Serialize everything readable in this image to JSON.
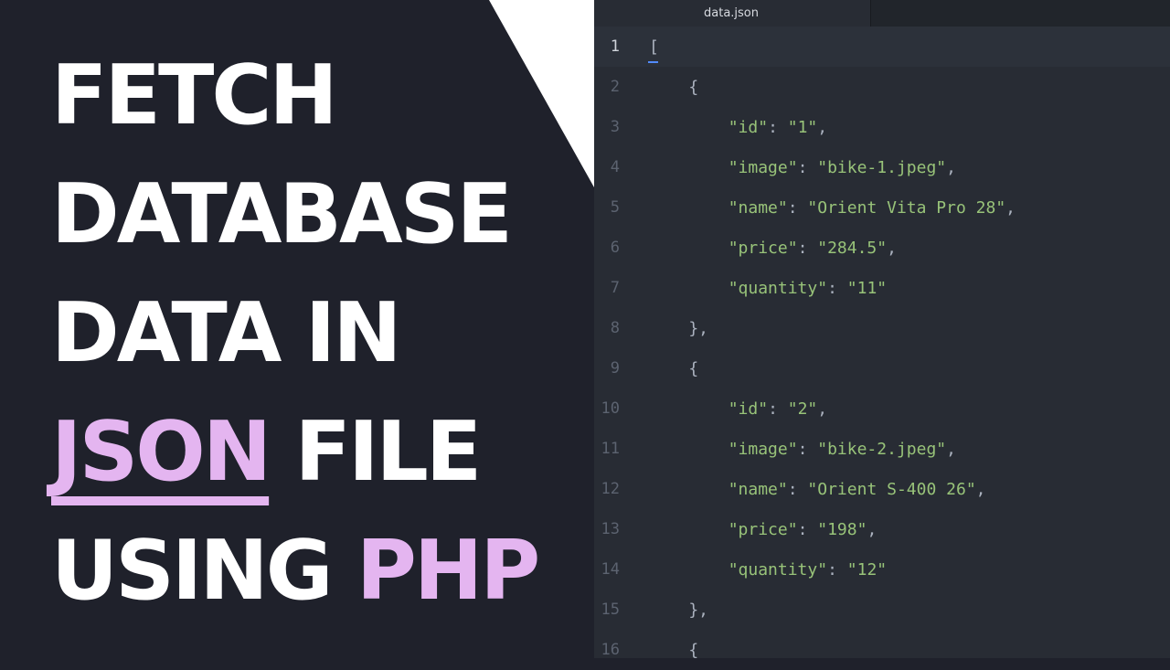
{
  "title": {
    "line1": "FETCH",
    "line2": "DATABASE",
    "line3": "DATA IN",
    "line4_highlight": "JSON",
    "line4_rest": " FILE",
    "line5_text": "USING ",
    "line5_highlight": "PHP"
  },
  "colors": {
    "accent": "#e4b5f0",
    "background": "#1f212b",
    "editor_bg": "#282c34",
    "string": "#98c379"
  },
  "editor": {
    "tab_label": "data.json",
    "lines": [
      {
        "n": "1",
        "indent": "",
        "text": "["
      },
      {
        "n": "2",
        "indent": "    ",
        "text": "{"
      },
      {
        "n": "3",
        "indent": "        ",
        "key": "\"id\"",
        "value": "\"1\"",
        "trail": ","
      },
      {
        "n": "4",
        "indent": "        ",
        "key": "\"image\"",
        "value": "\"bike-1.jpeg\"",
        "trail": ","
      },
      {
        "n": "5",
        "indent": "        ",
        "key": "\"name\"",
        "value": "\"Orient Vita Pro 28\"",
        "trail": ","
      },
      {
        "n": "6",
        "indent": "        ",
        "key": "\"price\"",
        "value": "\"284.5\"",
        "trail": ","
      },
      {
        "n": "7",
        "indent": "        ",
        "key": "\"quantity\"",
        "value": "\"11\"",
        "trail": ""
      },
      {
        "n": "8",
        "indent": "    ",
        "text": "},"
      },
      {
        "n": "9",
        "indent": "    ",
        "text": "{"
      },
      {
        "n": "10",
        "indent": "        ",
        "key": "\"id\"",
        "value": "\"2\"",
        "trail": ","
      },
      {
        "n": "11",
        "indent": "        ",
        "key": "\"image\"",
        "value": "\"bike-2.jpeg\"",
        "trail": ","
      },
      {
        "n": "12",
        "indent": "        ",
        "key": "\"name\"",
        "value": "\"Orient S-400 26\"",
        "trail": ","
      },
      {
        "n": "13",
        "indent": "        ",
        "key": "\"price\"",
        "value": "\"198\"",
        "trail": ","
      },
      {
        "n": "14",
        "indent": "        ",
        "key": "\"quantity\"",
        "value": "\"12\"",
        "trail": ""
      },
      {
        "n": "15",
        "indent": "    ",
        "text": "},"
      },
      {
        "n": "16",
        "indent": "    ",
        "text": "{"
      }
    ]
  }
}
